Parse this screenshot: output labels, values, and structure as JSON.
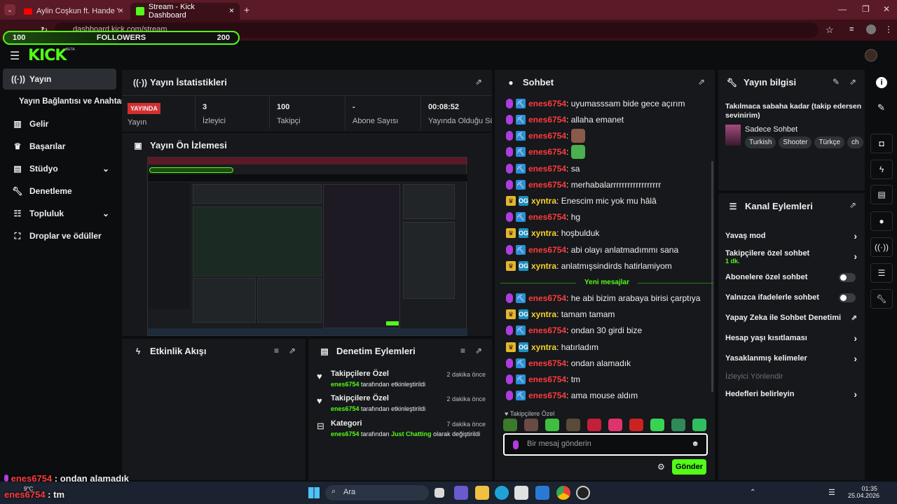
{
  "browser": {
    "tabs": [
      {
        "title": "Aylin Coşkun ft. Hande Yener - Ka",
        "active": false
      },
      {
        "title": "Stream - Kick Dashboard",
        "active": true
      }
    ],
    "new_tab": "+",
    "url": "dashboard.kick.com/stream"
  },
  "followers_bar": {
    "left": "100",
    "label": "FOLLOWERS",
    "right": "200",
    "progress": 0.5
  },
  "kick": {
    "logo": "KICK",
    "beta": "BETA"
  },
  "sidebar": {
    "items": [
      {
        "icon": "broadcast-icon",
        "label": "Yayın",
        "active": true
      },
      {
        "icon": "",
        "label": "Yayın Bağlantısı ve Anahtarı"
      },
      {
        "icon": "chart-icon",
        "label": "Gelir"
      },
      {
        "icon": "trophy-icon",
        "label": "Başarılar"
      },
      {
        "icon": "studio-icon",
        "label": "Stüdyo",
        "chevron": true
      },
      {
        "icon": "wrench-icon",
        "label": "Denetleme"
      },
      {
        "icon": "community-icon",
        "label": "Topluluk",
        "chevron": true
      },
      {
        "icon": "gift-icon",
        "label": "Droplar ve ödüller"
      }
    ]
  },
  "stats": {
    "title": "Yayın İstatistikleri",
    "live_badge": "YAYINDA",
    "live_label": "Yayın",
    "items": [
      {
        "value": "3",
        "label": "İzleyici"
      },
      {
        "value": "100",
        "label": "Takipçi"
      },
      {
        "value": "-",
        "label": "Abone Sayısı"
      },
      {
        "value": "00:08:52",
        "label": "Yayında Olduğu Süre"
      }
    ]
  },
  "preview": {
    "title": "Yayın Ön İzlemesi"
  },
  "activity": {
    "title": "Etkinlik Akışı"
  },
  "moderation": {
    "title": "Denetim Eylemleri",
    "items": [
      {
        "icon": "heart-icon",
        "title": "Takipçilere Özel",
        "time": "2 dakika önce",
        "user": "enes6754",
        "action": " tarafından etkinleştirildi"
      },
      {
        "icon": "heart-icon",
        "title": "Takipçilere Özel",
        "time": "2 dakika önce",
        "user": "enes6754",
        "action": " tarafından etkinleştirildi"
      },
      {
        "icon": "category-icon",
        "title": "Kategori",
        "time": "7 dakika önce",
        "user": "enes6754",
        "pre": " tarafından ",
        "category": "Just Chatting",
        "action": " olarak değiştirildi"
      }
    ]
  },
  "chat": {
    "title": "Sohbet",
    "messages": [
      {
        "user": "enes6754",
        "text": ": uyumasssam bide gece açırım",
        "type": "u1"
      },
      {
        "user": "enes6754",
        "text": ": allaha emanet",
        "type": "u1"
      },
      {
        "user": "enes6754",
        "text": ":",
        "type": "u1",
        "emote": "#8a5a4a"
      },
      {
        "user": "enes6754",
        "text": ":",
        "type": "u1",
        "emote": "#4caf50"
      },
      {
        "user": "enes6754",
        "text": ": sa",
        "type": "u1"
      },
      {
        "user": "enes6754",
        "text": ": merhabalarrrrrrrrrrrrrrrrrr",
        "type": "u1"
      },
      {
        "user": "xyntra",
        "text": ": Enescim mic yok mu hâlâ",
        "type": "u2"
      },
      {
        "user": "enes6754",
        "text": ": hg",
        "type": "u1"
      },
      {
        "user": "xyntra",
        "text": ": hoşbulduk",
        "type": "u2"
      },
      {
        "user": "enes6754",
        "text": ": abi olayı anlatmadımmı sana",
        "type": "u1"
      },
      {
        "user": "xyntra",
        "text": ": anlatmışsindirds hatirlamiyom",
        "type": "u2"
      },
      {
        "user": "enes6754",
        "text": ": he abi bizim arabaya birisi çarptıya",
        "type": "u1"
      },
      {
        "user": "xyntra",
        "text": ": tamam tamam",
        "type": "u2"
      },
      {
        "user": "enes6754",
        "text": ": ondan 30 girdi bize",
        "type": "u1"
      },
      {
        "user": "xyntra",
        "text": ": hatırladım",
        "type": "u2"
      },
      {
        "user": "enes6754",
        "text": ": ondan alamadık",
        "type": "u1"
      },
      {
        "user": "enes6754",
        "text": ": tm",
        "type": "u1"
      },
      {
        "user": "enes6754",
        "text": ": ama mouse aldım",
        "type": "u1"
      }
    ],
    "new_messages": "Yeni mesajlar",
    "followers_only": "Takipçilere Özel",
    "placeholder": "Bir mesaj gönderin",
    "send": "Gönder"
  },
  "stream_info": {
    "title": "Yayın bilgisi",
    "stream_title": "Takılmaca sabaha kadar (takip edersen sevinirim)",
    "category": "Sadece Sohbet",
    "tags": [
      "Turkish",
      "Shooter",
      "Türkçe",
      "ch"
    ]
  },
  "channel_actions": {
    "title": "Kanal Eylemleri",
    "items": [
      {
        "label": "Yavaş mod",
        "control": "chevron"
      },
      {
        "label": "Takipçilere özel sohbet",
        "sub": "1 dk.",
        "control": "chevron"
      },
      {
        "label": "Abonelere özel sohbet",
        "control": "toggle"
      },
      {
        "label": "Yalnızca ifadelerle sohbet",
        "control": "toggle"
      },
      {
        "label": "Yapay Zeka ile Sohbet Denetimi",
        "control": "external"
      },
      {
        "label": "Hesap yaşı kısıtlaması",
        "control": "chevron"
      },
      {
        "label": "Yasaklanmış kelimeler",
        "control": "chevron"
      },
      {
        "label": "İzleyici Yönlendir",
        "control": "disabled"
      },
      {
        "label": "Hedefleri belirleyin",
        "control": "chevron"
      }
    ]
  },
  "overlay_chat": [
    {
      "user": "enes6754",
      "text": " : ondan alamadık"
    },
    {
      "user": "enes6754",
      "text": " : tm"
    }
  ],
  "taskbar": {
    "weather": "9°C",
    "search": "Ara",
    "time": "01:35",
    "date": "25.04.2026"
  },
  "colors": {
    "accent": "#53fc18",
    "brand_tab": "#5a1a26",
    "user_red": "#ff3b3b",
    "user_yellow": "#f5d327"
  }
}
